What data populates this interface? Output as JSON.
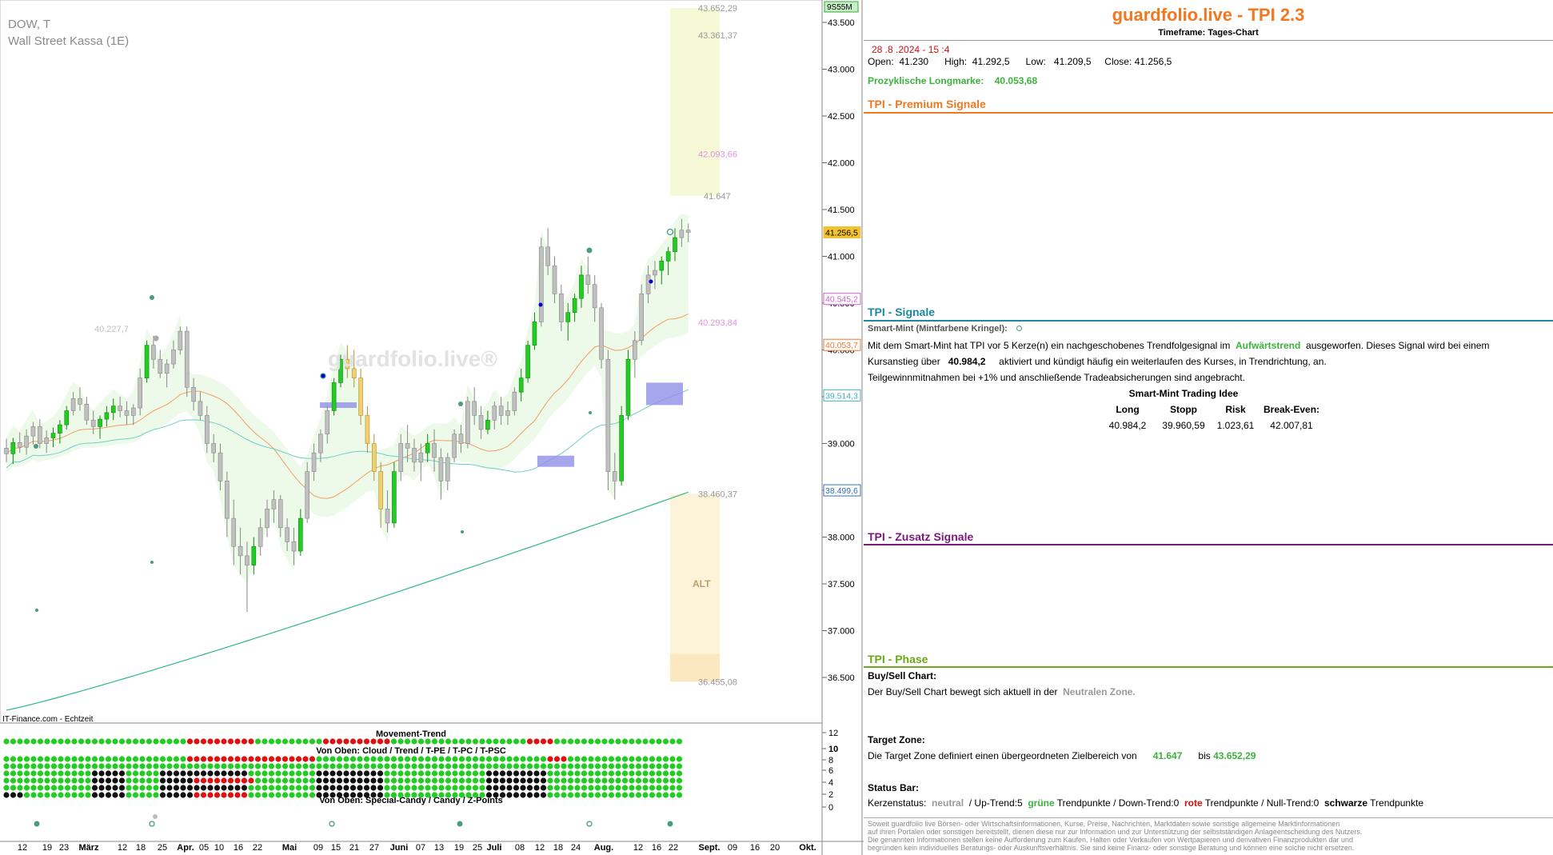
{
  "symbol": {
    "ticker": "DOW, T",
    "name": "Wall Street Kassa (1E)"
  },
  "watermark": "guardfolio.live",
  "source": "IT-Finance.com - Echtzeit",
  "time_badge": "9S55M",
  "chart_data": {
    "type": "candlestick",
    "ylim": [
      36200,
      43800
    ],
    "y_ticks": [
      "43.500",
      "43.000",
      "42.500",
      "42.000",
      "41.500",
      "41.000",
      "40.500",
      "40.000",
      "39.500",
      "39.000",
      "38.500",
      "38.000",
      "37.500",
      "37.000",
      "36.500"
    ],
    "x_tick_labels": [
      "12",
      "19",
      "23",
      "März",
      "12",
      "18",
      "25",
      "Apr.",
      "05",
      "10",
      "16",
      "22",
      "Mai",
      "09",
      "15",
      "21",
      "27",
      "Juni",
      "07",
      "13",
      "19",
      "25",
      "Juli",
      "08",
      "12",
      "18",
      "24",
      "Aug.",
      "12",
      "16",
      "22",
      "Sept.",
      "09",
      "16",
      "20",
      "Okt."
    ],
    "price_badges": [
      {
        "label": "41.256,5",
        "value": 41256.5,
        "color": "#f2c230"
      },
      {
        "label": "40.545,2",
        "value": 40545.2,
        "color": "#d060d0"
      },
      {
        "label": "40.053,7",
        "value": 40053.7,
        "color": "#f07830"
      },
      {
        "label": "39.514,3",
        "value": 39514.3,
        "color": "#40b0c0"
      },
      {
        "label": "38.499,6",
        "value": 38499.6,
        "color": "#3070c0"
      }
    ],
    "level_labels": [
      {
        "label": "43.652,29",
        "value": 43652.29
      },
      {
        "label": "43.361,37",
        "value": 43361.37
      },
      {
        "label": "42.093,66",
        "value": 42093.66
      },
      {
        "label": "41.647",
        "value": 41647
      },
      {
        "label": "40.293,84",
        "value": 40293.84
      },
      {
        "label": "40.227,7",
        "value": 40227.7
      },
      {
        "label": "38.460,37",
        "value": 38460.37
      },
      {
        "label": "36.455,08",
        "value": 36455.08
      }
    ],
    "target_zone": [
      41647,
      43652.29
    ],
    "alt_zone": [
      36455.08,
      38460.37
    ],
    "alt_label": "ALT",
    "candles": [
      [
        38950,
        39050,
        38800,
        38890
      ],
      [
        38890,
        39060,
        38780,
        39010
      ],
      [
        39010,
        39120,
        38900,
        38960
      ],
      [
        38960,
        39150,
        38880,
        39080
      ],
      [
        39080,
        39230,
        38990,
        39180
      ],
      [
        39180,
        39260,
        38950,
        39000
      ],
      [
        39000,
        39140,
        38900,
        39060
      ],
      [
        39060,
        39170,
        38960,
        39110
      ],
      [
        39110,
        39250,
        39000,
        39200
      ],
      [
        39200,
        39400,
        39150,
        39350
      ],
      [
        39350,
        39550,
        39300,
        39480
      ],
      [
        39480,
        39600,
        39350,
        39420
      ],
      [
        39420,
        39500,
        39200,
        39250
      ],
      [
        39250,
        39350,
        39100,
        39180
      ],
      [
        39180,
        39300,
        39050,
        39260
      ],
      [
        39260,
        39400,
        39180,
        39330
      ],
      [
        39330,
        39480,
        39250,
        39400
      ],
      [
        39400,
        39500,
        39280,
        39350
      ],
      [
        39350,
        39450,
        39200,
        39300
      ],
      [
        39300,
        39420,
        39200,
        39380
      ],
      [
        39380,
        39800,
        39300,
        39700
      ],
      [
        39700,
        40100,
        39650,
        40050
      ],
      [
        40050,
        40150,
        39800,
        39900
      ],
      [
        39900,
        40000,
        39700,
        39750
      ],
      [
        39750,
        39900,
        39600,
        39850
      ],
      [
        39850,
        40100,
        39800,
        40000
      ],
      [
        40000,
        40250,
        39950,
        40200
      ],
      [
        40200,
        40250,
        39500,
        39600
      ],
      [
        39600,
        39700,
        39350,
        39450
      ],
      [
        39450,
        39550,
        39250,
        39300
      ],
      [
        39300,
        39400,
        38900,
        39000
      ],
      [
        39000,
        39100,
        38800,
        38900
      ],
      [
        38900,
        39000,
        38500,
        38600
      ],
      [
        38600,
        38700,
        38000,
        38200
      ],
      [
        38200,
        38400,
        37700,
        37900
      ],
      [
        37900,
        38100,
        37600,
        37800
      ],
      [
        37800,
        37950,
        37200,
        37700
      ],
      [
        37700,
        38000,
        37600,
        37900
      ],
      [
        37900,
        38200,
        37800,
        38100
      ],
      [
        38100,
        38400,
        38000,
        38300
      ],
      [
        38300,
        38500,
        38150,
        38400
      ],
      [
        38400,
        38450,
        38000,
        38100
      ],
      [
        38100,
        38200,
        37850,
        37950
      ],
      [
        37950,
        38100,
        37700,
        37850
      ],
      [
        37850,
        38300,
        37800,
        38200
      ],
      [
        38200,
        38800,
        38150,
        38700
      ],
      [
        38700,
        39000,
        38600,
        38900
      ],
      [
        38900,
        39150,
        38800,
        39100
      ],
      [
        39100,
        39400,
        39000,
        39350
      ],
      [
        39350,
        39700,
        39300,
        39650
      ],
      [
        39650,
        39950,
        39600,
        39900
      ],
      [
        39900,
        40050,
        39700,
        39800
      ],
      [
        39800,
        40000,
        39600,
        39700
      ],
      [
        39700,
        39800,
        39200,
        39300
      ],
      [
        39300,
        39400,
        38900,
        39000
      ],
      [
        39000,
        39100,
        38600,
        38700
      ],
      [
        38700,
        38800,
        38100,
        38300
      ],
      [
        38300,
        38500,
        38050,
        38150
      ],
      [
        38150,
        38800,
        38100,
        38700
      ],
      [
        38700,
        39100,
        38600,
        39000
      ],
      [
        39000,
        39200,
        38800,
        38950
      ],
      [
        38950,
        39050,
        38700,
        38800
      ],
      [
        38800,
        39000,
        38600,
        38900
      ],
      [
        38900,
        39100,
        38800,
        39000
      ],
      [
        39000,
        39150,
        38700,
        38850
      ],
      [
        38850,
        38950,
        38400,
        38600
      ],
      [
        38600,
        38900,
        38500,
        38850
      ],
      [
        38850,
        39150,
        38800,
        39100
      ],
      [
        39100,
        39200,
        38900,
        39000
      ],
      [
        39000,
        39500,
        38950,
        39450
      ],
      [
        39450,
        39600,
        39200,
        39300
      ],
      [
        39300,
        39400,
        39050,
        39150
      ],
      [
        39150,
        39350,
        39100,
        39250
      ],
      [
        39250,
        39450,
        39150,
        39400
      ],
      [
        39400,
        39500,
        39200,
        39300
      ],
      [
        39300,
        39450,
        39200,
        39350
      ],
      [
        39350,
        39600,
        39300,
        39550
      ],
      [
        39550,
        39800,
        39450,
        39700
      ],
      [
        39700,
        40100,
        39650,
        40050
      ],
      [
        40050,
        40400,
        40000,
        40300
      ],
      [
        40300,
        41200,
        40250,
        41100
      ],
      [
        41100,
        41300,
        40800,
        40900
      ],
      [
        40900,
        41000,
        40500,
        40600
      ],
      [
        40600,
        40700,
        40200,
        40300
      ],
      [
        40300,
        40500,
        40100,
        40400
      ],
      [
        40400,
        40600,
        40300,
        40550
      ],
      [
        40550,
        40900,
        40450,
        40800
      ],
      [
        40800,
        41000,
        40600,
        40700
      ],
      [
        40700,
        40800,
        40300,
        40450
      ],
      [
        40450,
        40500,
        39800,
        39900
      ],
      [
        39900,
        40000,
        38500,
        38700
      ],
      [
        38700,
        38900,
        38400,
        38600
      ],
      [
        38600,
        39400,
        38550,
        39300
      ],
      [
        39300,
        40000,
        39250,
        39900
      ],
      [
        39900,
        40200,
        39700,
        40100
      ],
      [
        40100,
        40700,
        40050,
        40600
      ],
      [
        40600,
        40900,
        40500,
        40800
      ],
      [
        40800,
        40950,
        40650,
        40850
      ],
      [
        40850,
        41000,
        40700,
        40950
      ],
      [
        40950,
        41100,
        40800,
        41050
      ],
      [
        41050,
        41300,
        40950,
        41200
      ],
      [
        41200,
        41400,
        41100,
        41280
      ],
      [
        41280,
        41350,
        41150,
        41256
      ]
    ]
  },
  "indicator": {
    "title": "Movement-Trend",
    "sub1": "Von Oben: Cloud / Trend / T-PE / T-PC / T-PSC",
    "sub2": "Von Oben: Special-Candy / Candy / Z-Points",
    "y_ticks": [
      "12",
      "10",
      "8",
      "6",
      "4",
      "2",
      "0"
    ]
  },
  "panel": {
    "title": "guardfolio.live - TPI 2.3",
    "timeframe": "Timeframe: Tages-Chart",
    "date": "28 .8 .2024  - 15 :4",
    "open_label": "Open:",
    "open": "41.230",
    "high_label": "High:",
    "high": "41.292,5",
    "low_label": "Low:",
    "low": "41.209,5",
    "close_label": "Close:",
    "close": "41.256,5",
    "longmark_label": "Prozyklische Longmarke:",
    "longmark": "40.053,68",
    "premium_title": "TPI - Premium Signale",
    "signals_title": "TPI - Signale",
    "smartmint_label": "Smart-Mint (Mintfarbene Kringel):",
    "sig_text1a": "Mit dem Smart-Mint hat TPI vor 5  Kerze(n) ein nachgeschobenes Trendfolgesignal im",
    "sig_trend": "Aufwärtstrend",
    "sig_text1b": "ausgeworfen. Dieses Signal wird bei einem",
    "sig_text2a": "Kursanstieg über",
    "sig_level": "40.984,2",
    "sig_text2b": "aktiviert und kündigt häufig ein weiterlaufen des Kurses, in Trendrichtung, an.",
    "sig_text3": "Teilgewinnmitnahmen bei +1% und anschließende Tradeabsicherungen sind angebracht.",
    "idea_title": "Smart-Mint Trading Idee",
    "idea_headers": [
      "Long",
      "Stopp",
      "Risk",
      "Break-Even:"
    ],
    "idea_values": [
      "40.984,2",
      "39.960,59",
      "1.023,61",
      "42.007,81"
    ],
    "zusatz_title": "TPI - Zusatz Signale",
    "phase_title": "TPI - Phase",
    "buysell_label": "Buy/Sell Chart:",
    "buysell_text": "Der Buy/Sell Chart bewegt sich aktuell in der",
    "buysell_zone": "Neutralen Zone.",
    "target_label": "Target Zone:",
    "target_text": "Die Target Zone definiert einen übergeordneten Zielbereich von",
    "target_from": "41.647",
    "target_to_label": "bis",
    "target_to": "43.652,29",
    "status_label": "Status Bar:",
    "status_a": "Kerzenstatus:",
    "status_neutral": "neutral",
    "status_b": "/ Up-Trend:5",
    "status_green": "grüne",
    "status_c": "Trendpunkte  / Down-Trend:0",
    "status_red": "rote",
    "status_d": "Trendpunkte / Null-Trend:0",
    "status_black": "schwarze",
    "status_e": "Trendpunkte",
    "disclaimer": [
      "Soweit guardfolio live Börsen- oder Wirtschaftsinformationen, Kurse, Preise, Nachrichten, Marktdaten sowie sonstige allgemeine Marktinformationen",
      "auf ihren Portalen oder sonstigen bereitstellt, dienen diese nur zur Information und zur Unterstützung der selbstständigen Anlageentscheidung des Nutzers.",
      "Die genannten Informationen stellen keine Aufforderung zum Kaufen, Halten oder Verkaufen von Wertpapieren und derivativen Finanzprodukten dar und",
      "begründen kein individuelles Beratungs- oder Auskunftsverhältnis. Sie sind keine Finanz- oder sonstige Beratung und können eine solche nicht ersetzen."
    ]
  }
}
